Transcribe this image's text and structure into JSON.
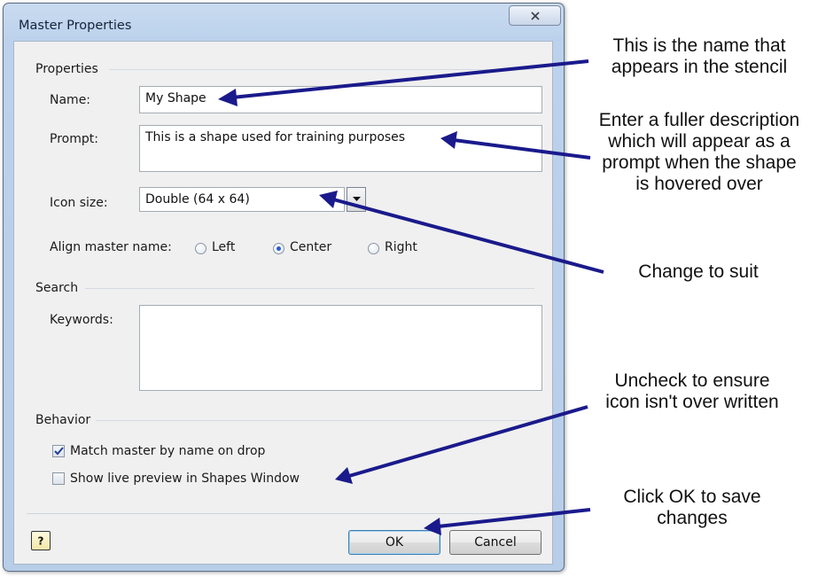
{
  "dialog": {
    "title": "Master Properties",
    "close_glyph": "✕"
  },
  "properties": {
    "group_label": "Properties",
    "name_label": "Name:",
    "name_value": "My Shape",
    "prompt_label": "Prompt:",
    "prompt_value": "This is a shape used for training purposes",
    "icon_size_label": "Icon size:",
    "icon_size_value": "Double (64 x 64)",
    "align_label": "Align master name:",
    "align_options": [
      {
        "label": "Left",
        "checked": false
      },
      {
        "label": "Center",
        "checked": true
      },
      {
        "label": "Right",
        "checked": false
      }
    ]
  },
  "search": {
    "group_label": "Search",
    "keywords_label": "Keywords:",
    "keywords_value": ""
  },
  "behavior": {
    "group_label": "Behavior",
    "match_label": "Match master by name on drop",
    "match_checked": true,
    "live_preview_label": "Show live preview in Shapes Window",
    "live_preview_checked": false
  },
  "footer": {
    "ok_label": "OK",
    "cancel_label": "Cancel",
    "help_glyph": "?"
  },
  "annotations": {
    "name": [
      "This is the name that",
      "appears in the stencil"
    ],
    "prompt": [
      "Enter a fuller description",
      "which will appear as a",
      "prompt when the shape",
      "is hovered over"
    ],
    "icon_size": [
      "Change to suit"
    ],
    "live_preview": [
      "Uncheck to ensure",
      "icon isn't over written"
    ],
    "ok": [
      "Click OK to save",
      "changes"
    ]
  },
  "colors": {
    "arrow": "#1a1a8c",
    "frame": "#b7cde8",
    "client": "#f0f0f0"
  }
}
